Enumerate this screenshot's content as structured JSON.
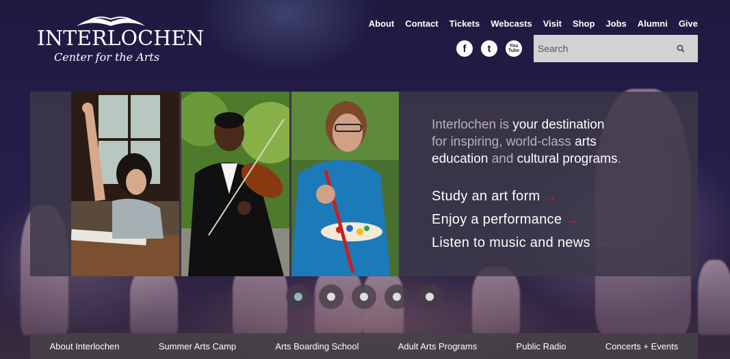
{
  "brand": {
    "name": "INTERLOCHEN",
    "subtitle": "Center for the Arts"
  },
  "topnav": [
    "About",
    "Contact",
    "Tickets",
    "Webcasts",
    "Visit",
    "Shop",
    "Jobs",
    "Alumni",
    "Give"
  ],
  "social": [
    {
      "icon": "facebook-icon",
      "glyph": "f"
    },
    {
      "icon": "twitter-icon",
      "glyph": "t"
    },
    {
      "icon": "youtube-icon",
      "glyph": "You Tube"
    }
  ],
  "search": {
    "placeholder": "Search"
  },
  "hero": {
    "tagline": {
      "part1": "Interlochen is ",
      "part2": "your destination",
      "part3": "for inspiring, world-class ",
      "part4": "arts",
      "part5": "education ",
      "part6": "and ",
      "part7": "cultural programs",
      "part8": "."
    },
    "links": [
      {
        "label": "Study an art form",
        "arrow": "→"
      },
      {
        "label": "Enjoy a performance",
        "arrow": "→"
      },
      {
        "label": "Listen to music and news",
        "arrow": "→"
      }
    ]
  },
  "carousel": {
    "count": 5,
    "active_index": 0
  },
  "bottomnav": [
    "About Interlochen",
    "Summer Arts Camp",
    "Arts Boarding School",
    "Adult Arts Programs",
    "Public Radio",
    "Concerts + Events"
  ],
  "colors": {
    "accent_arrow": "#c2272d",
    "active_dot": "#8fb6c8"
  }
}
